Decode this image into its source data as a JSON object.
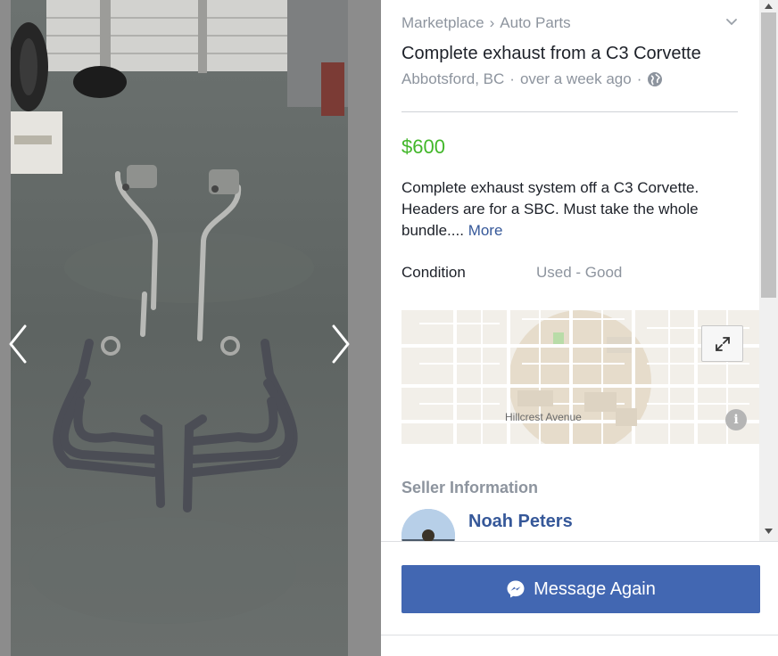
{
  "breadcrumb": {
    "root": "Marketplace",
    "separator": "›",
    "category": "Auto Parts"
  },
  "listing": {
    "title": "Complete exhaust from a C3 Corvette",
    "location": "Abbotsford, BC",
    "time": "over a week ago",
    "dot": "·",
    "price": "$600",
    "description": "Complete exhaust system off a C3 Corvette. Headers are for a SBC. Must take the whole bundle....",
    "more_label": "More",
    "condition_label": "Condition",
    "condition_value": "Used - Good"
  },
  "map": {
    "street_label": "Hillcrest Avenue",
    "info_glyph": "i"
  },
  "seller": {
    "heading": "Seller Information",
    "name": "Noah Peters"
  },
  "actions": {
    "message_label": "Message Again"
  },
  "icons": {
    "chevron": "chevron-down-icon",
    "globe": "globe-icon",
    "expand": "expand-icon",
    "messenger": "messenger-icon",
    "prev": "chevron-left-icon",
    "next": "chevron-right-icon"
  },
  "colors": {
    "price": "#42b72a",
    "link": "#365899",
    "button": "#4267b2",
    "muted": "#8d949e",
    "text": "#1d2129"
  }
}
